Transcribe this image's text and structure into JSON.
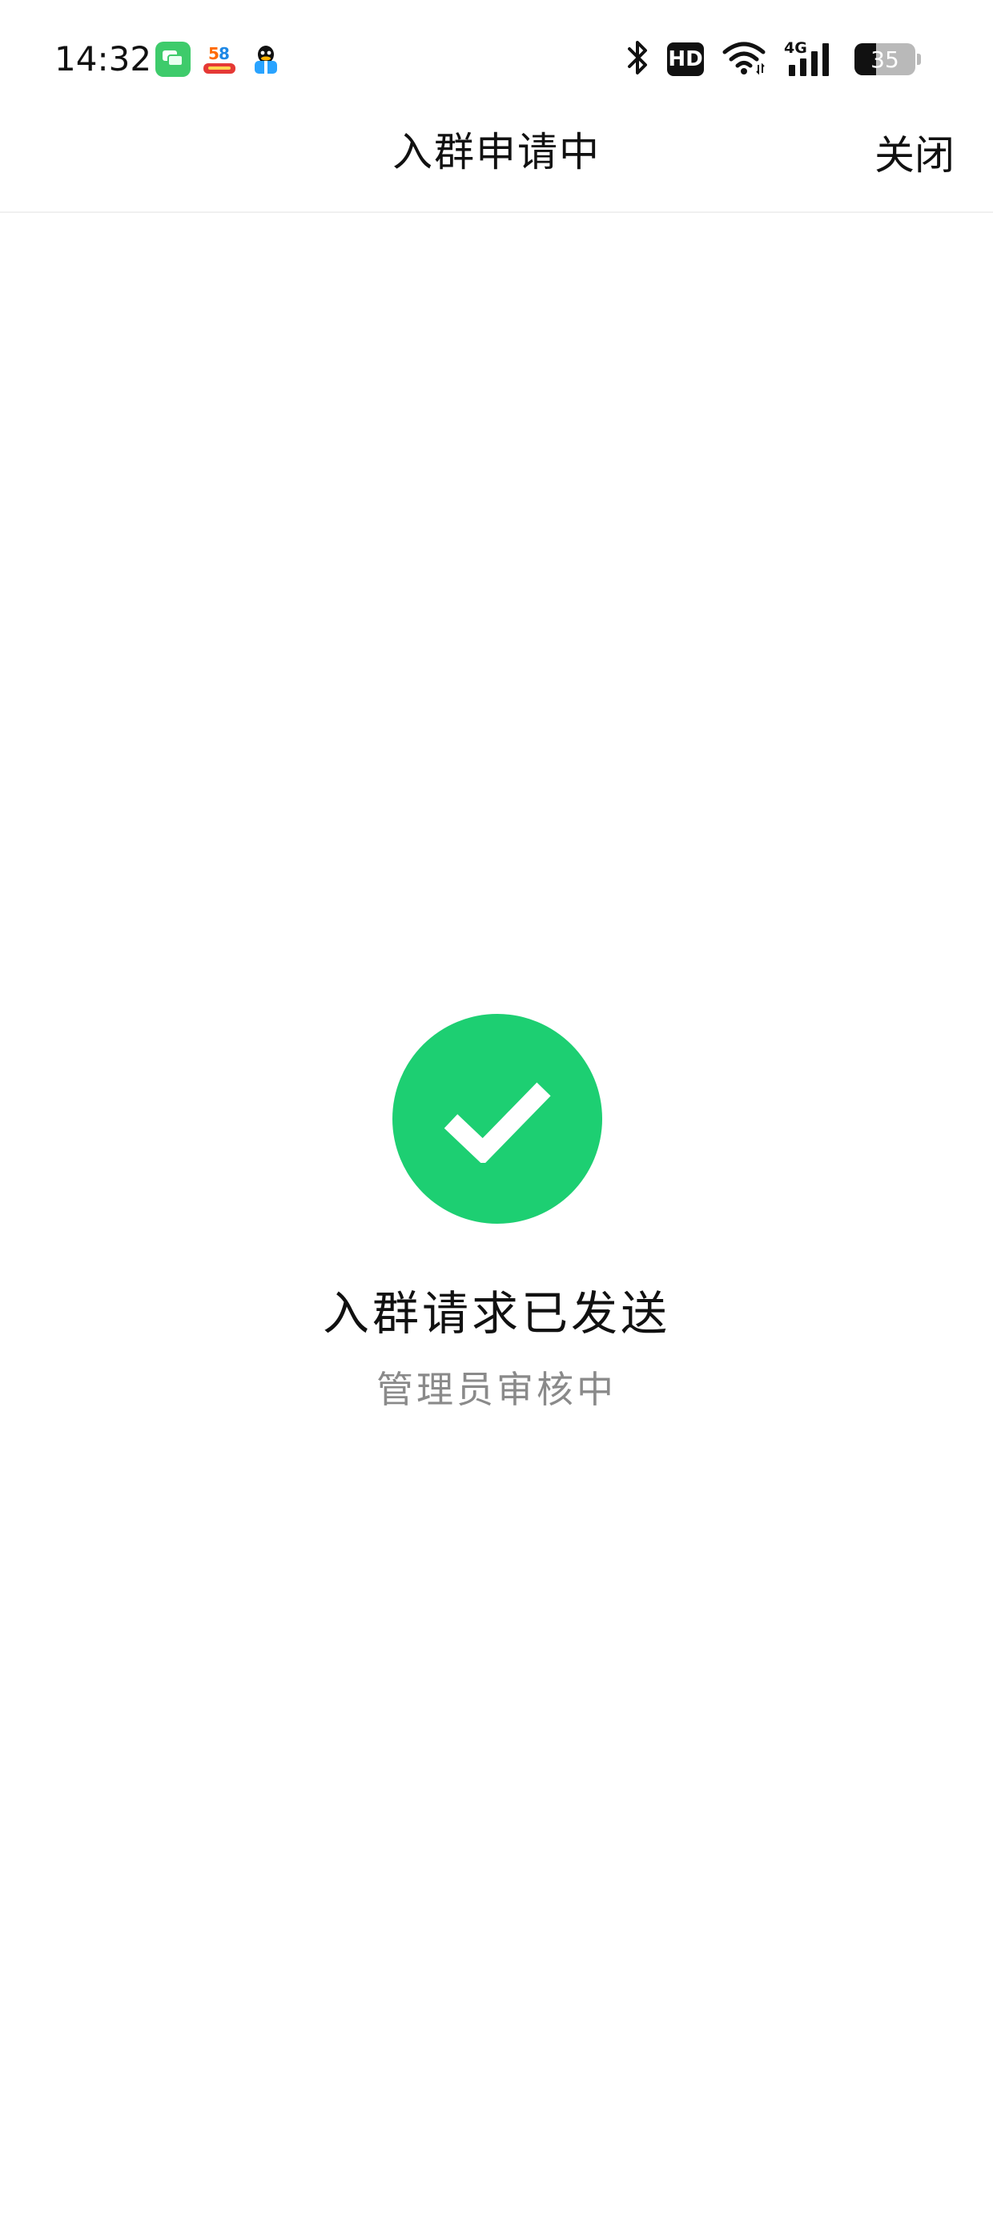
{
  "status_bar": {
    "time": "14:32",
    "notification_icons": [
      "messages-app-icon",
      "58-app-icon",
      "qq-app-icon"
    ],
    "system_icons": [
      "bluetooth-icon",
      "hd-icon",
      "wifi-icon",
      "signal-4g-icon",
      "battery-icon"
    ],
    "hd_label": "HD",
    "network_label": "4G",
    "battery_level": "35"
  },
  "header": {
    "title": "入群申请中",
    "close_label": "关闭"
  },
  "result": {
    "title": "入群请求已发送",
    "subtitle": "管理员审核中"
  },
  "colors": {
    "success_green": "#1DCF72",
    "subtitle_gray": "#8A8A8A",
    "text_primary": "#111111"
  }
}
